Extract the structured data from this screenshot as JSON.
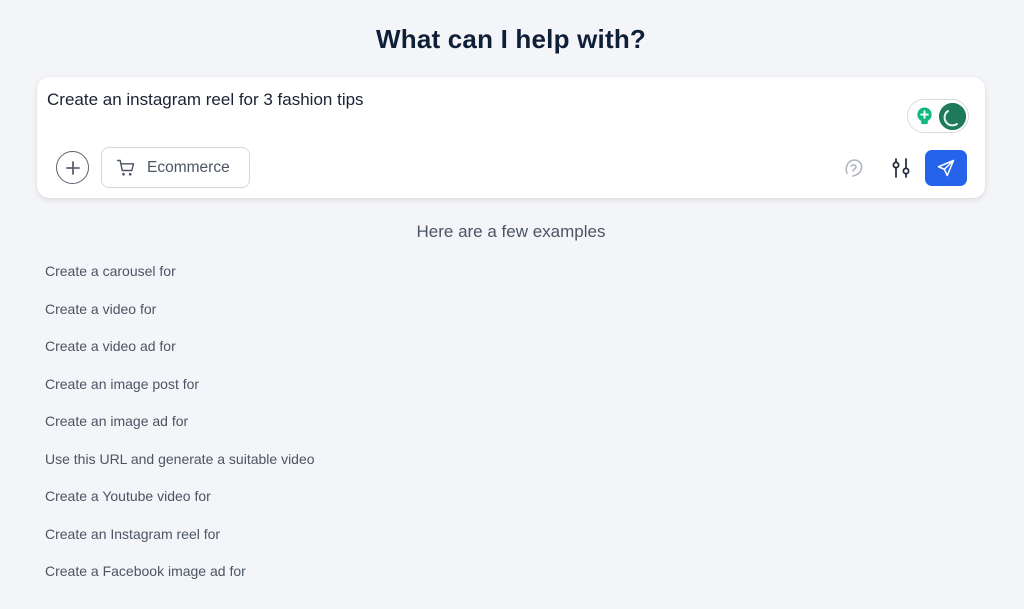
{
  "heading": "What can I help with?",
  "prompt": {
    "text": "Create an instagram reel for 3 fashion tips"
  },
  "toolbar": {
    "add_icon": "plus-circle-icon",
    "category_chip": {
      "icon": "shopping-cart-icon",
      "label": "Ecommerce"
    },
    "avatar_icon": "face-icon",
    "settings_icon": "sliders-icon",
    "send_icon": "paper-plane-icon"
  },
  "assistant_badge": {
    "icons": [
      "lightbulb-icon",
      "assistant-avatar-icon"
    ]
  },
  "examples": {
    "heading": "Here are a few examples",
    "items": [
      "Create a carousel for",
      "Create a video for",
      "Create a video ad for",
      "Create an image post for",
      "Create an image ad for",
      "Use this URL and generate a suitable video",
      "Create a Youtube video for",
      "Create an Instagram reel for",
      "Create a Facebook image ad for"
    ]
  },
  "colors": {
    "background": "#f4f5f8",
    "accent": "#2563eb",
    "heading": "#0f1f38",
    "badge_green": "#10b981",
    "avatar_green": "#1f7a5c"
  }
}
